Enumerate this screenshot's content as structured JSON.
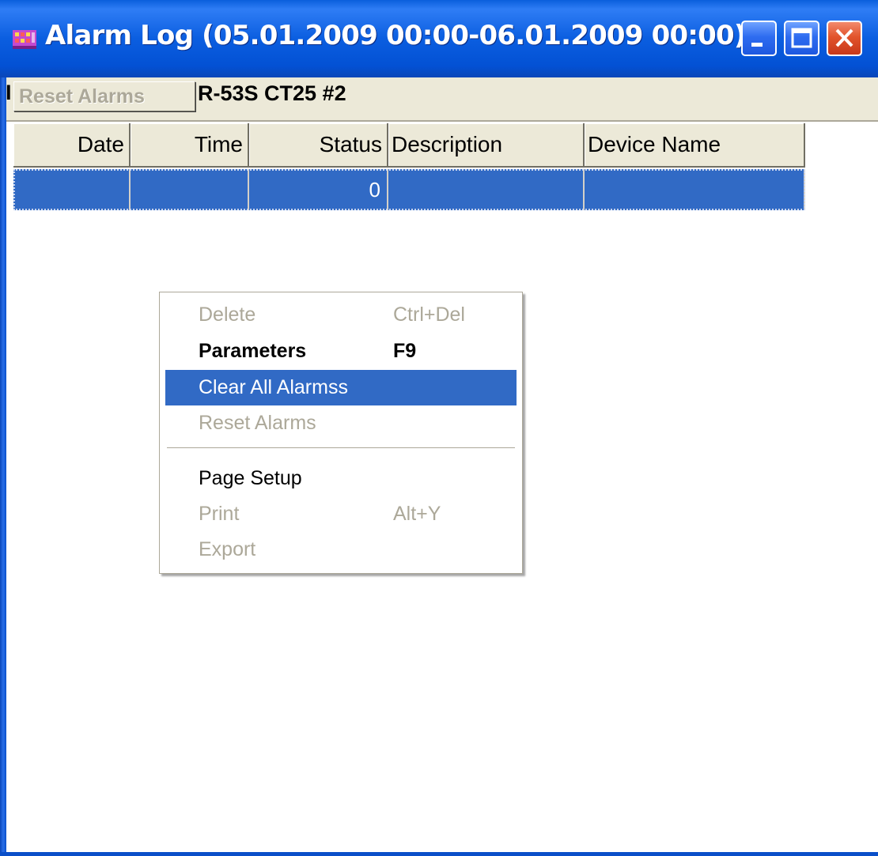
{
  "window": {
    "title": "Alarm Log (05.01.2009 00:00-06.01.2009 00:00)",
    "icon": "alarm-log-app-icon",
    "controls": [
      "minimize-icon",
      "maximize-icon",
      "close-icon"
    ]
  },
  "toolbar": {
    "reset_button_label": "Reset Alarms",
    "partial_left_text": "I",
    "device_label": "R-53S CT25 #2"
  },
  "grid": {
    "columns": [
      "Date",
      "Time",
      "Status",
      "Description",
      "Device Name"
    ],
    "rows": [
      {
        "date": "",
        "time": "",
        "status": "0",
        "description": "",
        "device_name": ""
      }
    ],
    "selected_row_color": "#316ac5"
  },
  "context_menu": {
    "items": [
      {
        "label": "Delete",
        "shortcut": "Ctrl+Del",
        "enabled": false,
        "bold": false
      },
      {
        "label": "Parameters",
        "shortcut": "F9",
        "enabled": true,
        "bold": true
      },
      {
        "label": "Clear All  Alarmss",
        "shortcut": "",
        "enabled": true,
        "bold": false,
        "highlighted": true
      },
      {
        "label": "Reset Alarms",
        "shortcut": "",
        "enabled": false,
        "bold": false
      },
      {
        "label": "Page Setup",
        "shortcut": "",
        "enabled": true,
        "bold": false
      },
      {
        "label": "Print",
        "shortcut": "Alt+Y",
        "enabled": false,
        "bold": false
      },
      {
        "label": "Export",
        "shortcut": "",
        "enabled": false,
        "bold": false
      }
    ]
  },
  "colors": {
    "titlebar": "#0b5ee0",
    "selection": "#316ac5",
    "disabled_text": "#aca899",
    "chrome": "#ece9d8"
  }
}
